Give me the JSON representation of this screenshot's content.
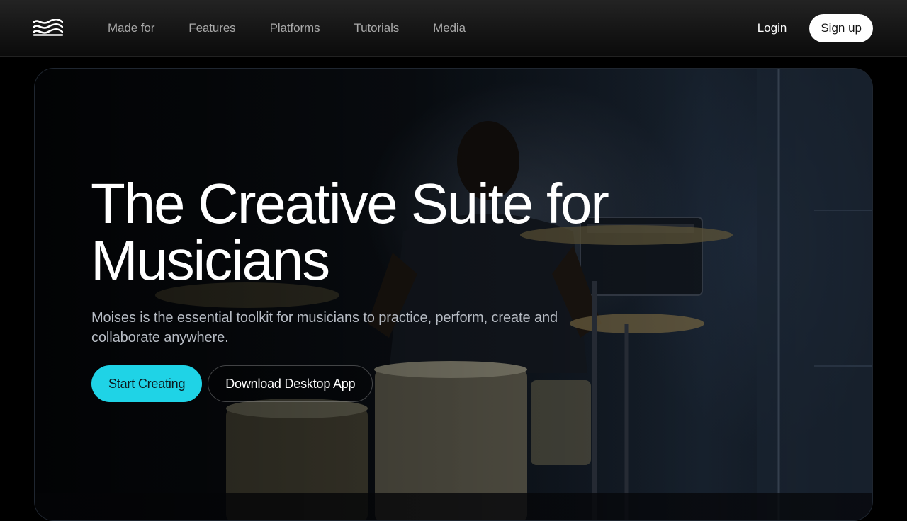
{
  "brand": {
    "logo_icon": "moises-wave-logo-icon"
  },
  "nav": {
    "links": [
      "Made for",
      "Features",
      "Platforms",
      "Tutorials",
      "Media"
    ],
    "login_label": "Login",
    "signup_label": "Sign up"
  },
  "hero": {
    "image": "drummer-in-studio-photo",
    "title_line1": "The Creative Suite for",
    "title_line2": "Musicians",
    "subtitle_line1": "Moises is the essential toolkit for musicians to practice, perform, create and",
    "subtitle_line2": "collaborate anywhere.",
    "primary_cta": "Start Creating",
    "secondary_cta": "Download Desktop App"
  },
  "colors": {
    "accent": "#1fd3e6",
    "nav_link": "#a9a9a9",
    "background": "#000000"
  }
}
